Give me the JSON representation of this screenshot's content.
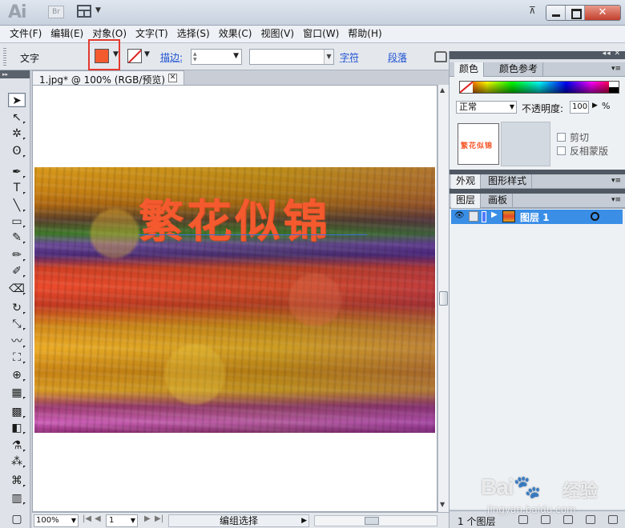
{
  "titlebar": {
    "app_logo": "Ai",
    "bridge_badge": "Br",
    "restore_glyph": "⊼",
    "min_label": "",
    "max_label": "",
    "close_label": "✕"
  },
  "menu": {
    "items": [
      "文件(F)",
      "编辑(E)",
      "对象(O)",
      "文字(T)",
      "选择(S)",
      "效果(C)",
      "视图(V)",
      "窗口(W)",
      "帮助(H)"
    ]
  },
  "control_bar": {
    "context_label": "文字",
    "fill_color": "#f45a2e",
    "stroke_label": "描边:",
    "stroke_weight": "",
    "style_value": "",
    "character_link": "字符",
    "paragraph_link": "段落"
  },
  "document": {
    "tab_label": "1.jpg* @ 100% (RGB/预览)",
    "tab_close": "✕",
    "artwork_text": "繁花似锦",
    "text_color": "#f45a2e"
  },
  "status_bar": {
    "zoom": "100%",
    "page": "1",
    "status_text": "编组选择"
  },
  "color_panel": {
    "tabs": [
      "颜色",
      "颜色参考"
    ]
  },
  "transparency_panel": {
    "blend_mode": "正常",
    "opacity_label": "不透明度:",
    "opacity_value": "100",
    "opacity_unit": "%",
    "mask_preview_text": "繁花似锦",
    "clip_label": "剪切",
    "invert_label": "反相蒙版"
  },
  "appearance_panel": {
    "tabs": [
      "外观",
      "图形样式"
    ]
  },
  "layers_panel": {
    "tabs": [
      "图层",
      "画板"
    ],
    "layers": [
      {
        "name": "图层 1",
        "color": "#4f79ff"
      }
    ],
    "layer_count": "1 个图层"
  },
  "watermark": {
    "logo": "Bai🐾",
    "cn": "经验",
    "url": "jingyan.baidu.com"
  }
}
